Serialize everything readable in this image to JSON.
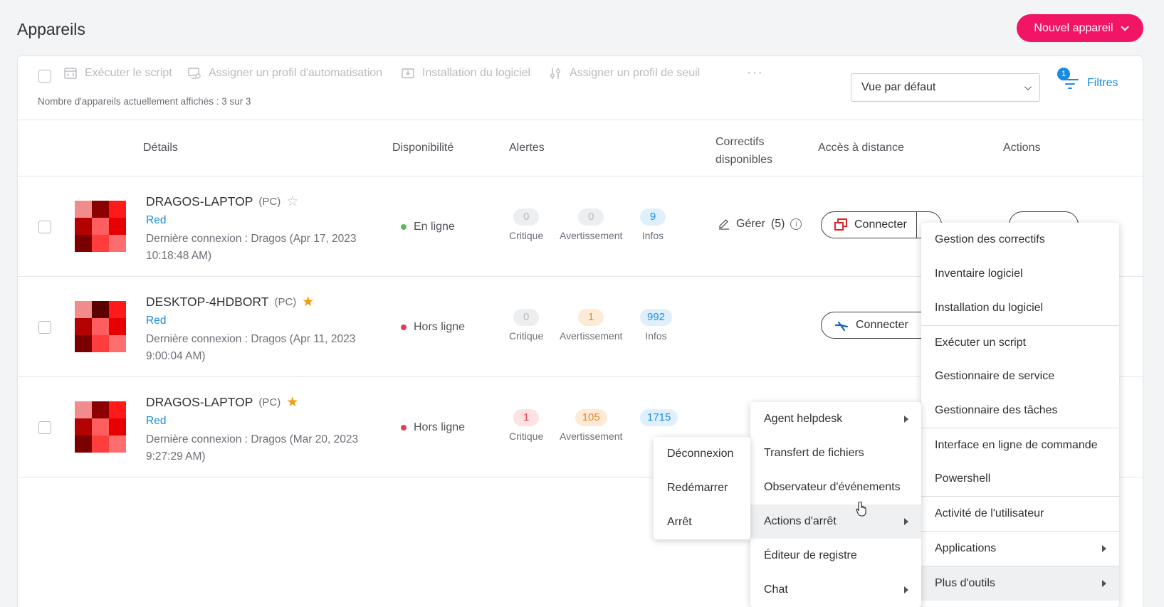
{
  "page": {
    "title": "Appareils",
    "new_device_label": "Nouvel appareil"
  },
  "toolbar": {
    "run_script": "Exécuter le script",
    "assign_automation": "Assigner un profil d'automatisation",
    "install_software": "Installation du logiciel",
    "assign_threshold": "Assigner un profil de seuil",
    "more": "···",
    "count_text": "Nombre d'appareils actuellement affichés : 3 sur 3",
    "view_select": "Vue par défaut",
    "filters_label": "Filtres",
    "filters_count": "1"
  },
  "table": {
    "headers": {
      "details": "Détails",
      "availability": "Disponibilité",
      "alerts": "Alertes",
      "patches_line1": "Correctifs",
      "patches_line2": "disponibles",
      "remote": "Accès à distance",
      "actions": "Actions"
    },
    "alert_labels": {
      "critical": "Critique",
      "warning": "Avertissement",
      "info": "Infos"
    },
    "rows": [
      {
        "name": "DRAGOS-LAPTOP",
        "type": "(PC)",
        "starred": false,
        "tag": "Red",
        "last_login": "Dernière connexion : Dragos (Apr 17, 2023 10:18:48 AM)",
        "status": "En ligne",
        "status_color": "#5cb85c",
        "critical": "0",
        "warning": "0",
        "info": "9",
        "manage": "Gérer",
        "manage_count": "(5)",
        "connect": "Connecter"
      },
      {
        "name": "DESKTOP-4HDBORT",
        "type": "(PC)",
        "starred": true,
        "tag": "Red",
        "last_login": "Dernière connexion : Dragos (Apr 11, 2023 9:00:04 AM)",
        "status": "Hors ligne",
        "status_color": "#e2404f",
        "critical": "0",
        "warning": "1",
        "info": "992",
        "connect": "Connecter"
      },
      {
        "name": "DRAGOS-LAPTOP",
        "type": "(PC)",
        "starred": true,
        "tag": "Red",
        "last_login": "Dernière connexion : Dragos (Mar 20, 2023 9:27:29 AM)",
        "status": "Hors ligne",
        "status_color": "#e2404f",
        "critical": "1",
        "warning": "105",
        "info": "1715"
      }
    ]
  },
  "actions_menu": [
    "Gestion des correctifs",
    "Inventaire logiciel",
    "Installation du logiciel",
    "Exécuter un script",
    "Gestionnaire de service",
    "Gestionnaire des tâches",
    "Interface en ligne de commande",
    "Powershell",
    "Activité de l'utilisateur",
    "Applications",
    "Plus d'outils"
  ],
  "tools_submenu": [
    "Agent helpdesk",
    "Transfert de fichiers",
    "Observateur d'événements",
    "Actions d'arrêt",
    "Éditeur de registre",
    "Chat"
  ],
  "shutdown_submenu": [
    "Déconnexion",
    "Redémarrer",
    "Arrêt"
  ],
  "colors": {
    "brand": "#f21566",
    "accent": "#1a8ce0",
    "star": "#f39c12"
  }
}
